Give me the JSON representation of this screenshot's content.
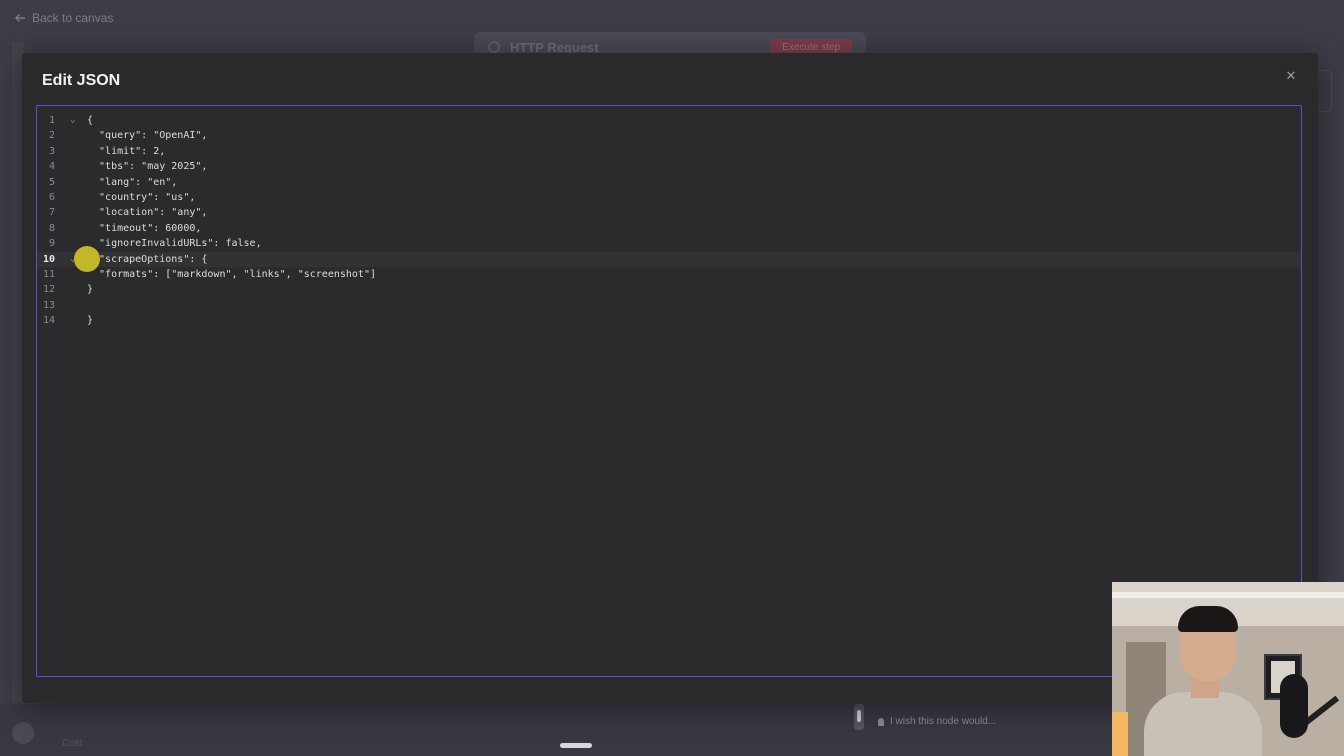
{
  "background": {
    "back_link": "Back to canvas",
    "node_title": "HTTP Request",
    "execute_label": "Execute step",
    "cost_label": "Cost",
    "feedback_placeholder": "I wish this node would..."
  },
  "modal": {
    "title": "Edit JSON",
    "close_icon": "close-icon"
  },
  "editor": {
    "active_line": 10,
    "lines": [
      {
        "n": "1",
        "text": "{"
      },
      {
        "n": "2",
        "text": "  \"query\": \"OpenAI\","
      },
      {
        "n": "3",
        "text": "  \"limit\": 2,"
      },
      {
        "n": "4",
        "text": "  \"tbs\": \"may 2025\","
      },
      {
        "n": "5",
        "text": "  \"lang\": \"en\","
      },
      {
        "n": "6",
        "text": "  \"country\": \"us\","
      },
      {
        "n": "7",
        "text": "  \"location\": \"any\","
      },
      {
        "n": "8",
        "text": "  \"timeout\": 60000,"
      },
      {
        "n": "9",
        "text": "  \"ignoreInvalidURLs\": false,"
      },
      {
        "n": "10",
        "text": "  \"scrapeOptions\": {"
      },
      {
        "n": "11",
        "text": "  \"formats\": [\"markdown\", \"links\", \"screenshot\"]"
      },
      {
        "n": "12",
        "text": "}"
      },
      {
        "n": "13",
        "text": ""
      },
      {
        "n": "14",
        "text": "}"
      }
    ]
  },
  "colors": {
    "accent": "#5a4fd6",
    "cursor_highlight": "#e2d628",
    "execute_button": "#7a3d48"
  }
}
